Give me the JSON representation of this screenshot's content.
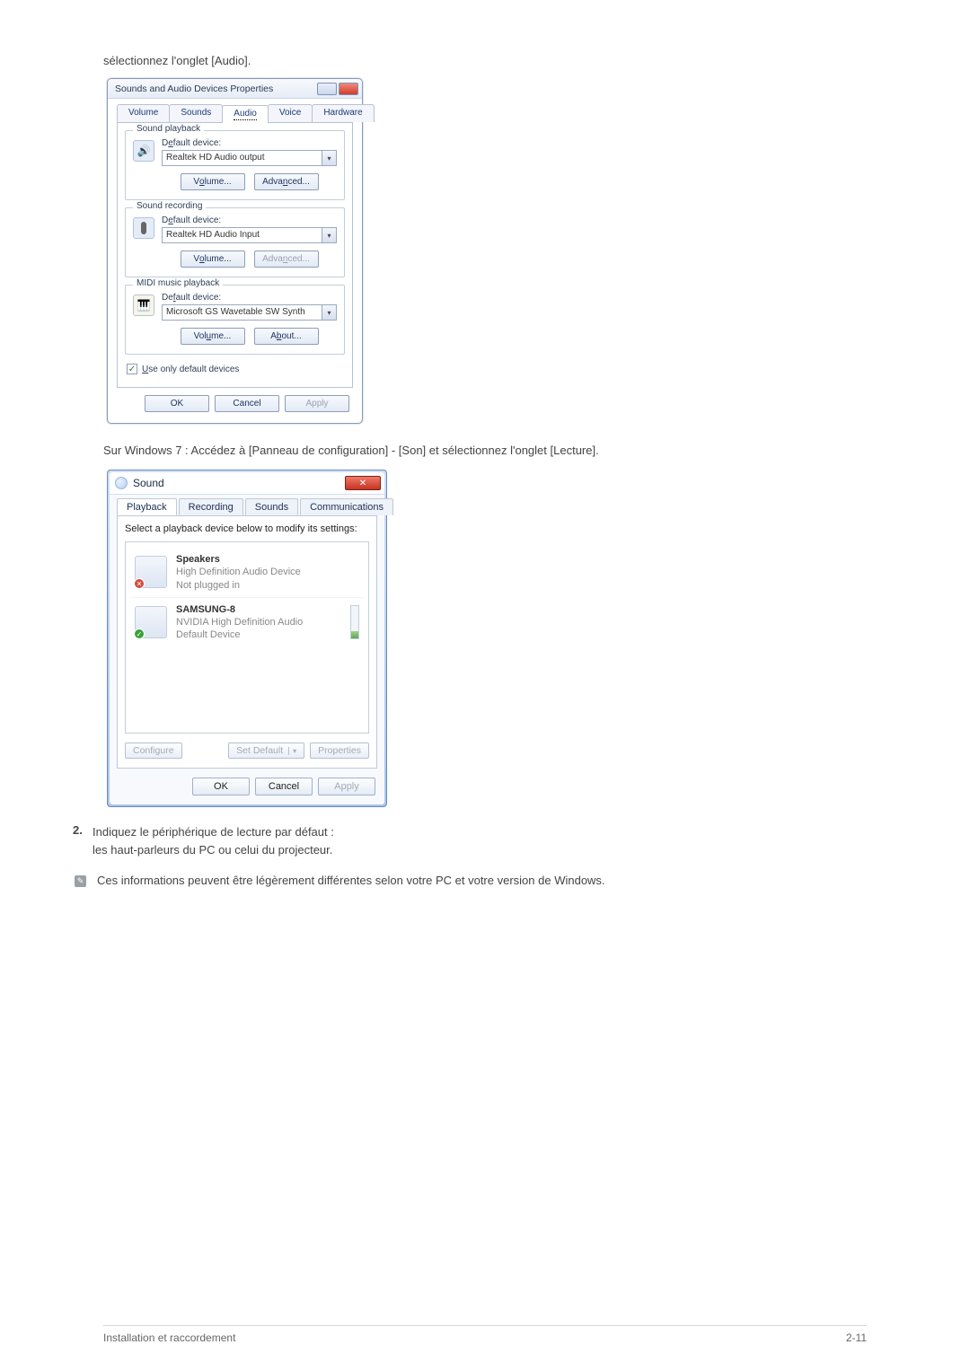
{
  "intro_text": "sélectionnez l'onglet [Audio].",
  "xp": {
    "title": "Sounds and Audio Devices Properties",
    "tabs": {
      "volume": "Volume",
      "sounds": "Sounds",
      "audio": "Audio",
      "voice": "Voice",
      "hardware": "Hardware"
    },
    "playback": {
      "group": "Sound playback",
      "label_pre": "D",
      "label_u": "e",
      "label_post": "fault device:",
      "value": "Realtek HD Audio output",
      "btn1_pre": "V",
      "btn1_u": "o",
      "btn1_post": "lume...",
      "btn2_pre": "Adva",
      "btn2_u": "n",
      "btn2_post": "ced..."
    },
    "recording": {
      "group": "Sound recording",
      "label_pre": "D",
      "label_u": "e",
      "label_post": "fault device:",
      "value": "Realtek HD Audio Input",
      "btn1_pre": "V",
      "btn1_u": "o",
      "btn1_post": "lume...",
      "btn2_pre": "Adva",
      "btn2_u": "n",
      "btn2_post": "ced..."
    },
    "midi": {
      "group": "MIDI music playback",
      "label_pre": "De",
      "label_u": "f",
      "label_post": "ault device:",
      "value": "Microsoft GS Wavetable SW Synth",
      "btn1_pre": "Vol",
      "btn1_u": "u",
      "btn1_post": "me...",
      "btn2_pre": "A",
      "btn2_u": "b",
      "btn2_post": "out..."
    },
    "use_default_pre": "",
    "use_default_u": "U",
    "use_default_post": "se only default devices",
    "ok": "OK",
    "cancel": "Cancel",
    "apply": "Apply"
  },
  "win7_intro": "Sur Windows 7 : Accédez à [Panneau de configuration] - [Son] et sélectionnez l'onglet [Lecture].",
  "w7": {
    "title": "Sound",
    "tabs": {
      "playback": "Playback",
      "recording": "Recording",
      "sounds": "Sounds",
      "communications": "Communications"
    },
    "instruction": "Select a playback device below to modify its settings:",
    "items": [
      {
        "name": "Speakers",
        "line2": "High Definition Audio Device",
        "status": "Not plugged in",
        "badge": "red"
      },
      {
        "name": "SAMSUNG-8",
        "line2": "NVIDIA High Definition Audio",
        "status": "Default Device",
        "badge": "green"
      }
    ],
    "configure": "Configure",
    "set_default": "Set Default",
    "properties": "Properties",
    "ok": "OK",
    "cancel": "Cancel",
    "apply": "Apply"
  },
  "step2_num": "2.",
  "step2_line1": "Indiquez le périphérique de lecture par défaut :",
  "step2_line2": "les haut-parleurs du PC ou celui du projecteur.",
  "note_text": "Ces informations peuvent être légèrement différentes selon votre PC et votre version de Windows.",
  "footer_left": "Installation et raccordement",
  "footer_right": "2-11"
}
